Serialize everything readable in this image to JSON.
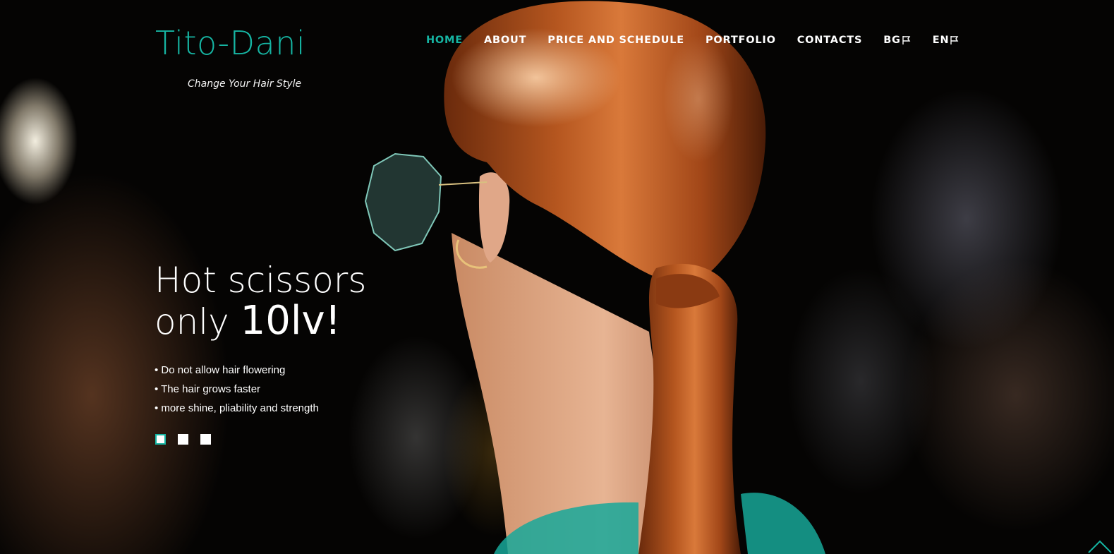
{
  "brand": {
    "logo_text": "Tito-Dani",
    "tagline": "Change Your Hair Style",
    "accent_color": "#16b5a3"
  },
  "nav": {
    "items": [
      {
        "label": "HOME",
        "active": true
      },
      {
        "label": "ABOUT",
        "active": false
      },
      {
        "label": "PRICE AND SCHEDULE",
        "active": false
      },
      {
        "label": "PORTFOLIO",
        "active": false
      },
      {
        "label": "CONTACTS",
        "active": false
      },
      {
        "label": "BG",
        "active": false,
        "icon": "flag-icon"
      },
      {
        "label": "EN",
        "active": false,
        "icon": "flag-icon"
      }
    ]
  },
  "slider": {
    "title_line1": "Hot scissors",
    "title_line2_prefix": "only ",
    "title_price": "10lv!",
    "bullets": [
      "• Do not allow hair flowering",
      "• The hair grows faster",
      "• more shine, pliability and strength"
    ],
    "slide_count": 3,
    "active_slide": 1
  },
  "icons": {
    "back_to_top": "chevron-up-icon"
  }
}
